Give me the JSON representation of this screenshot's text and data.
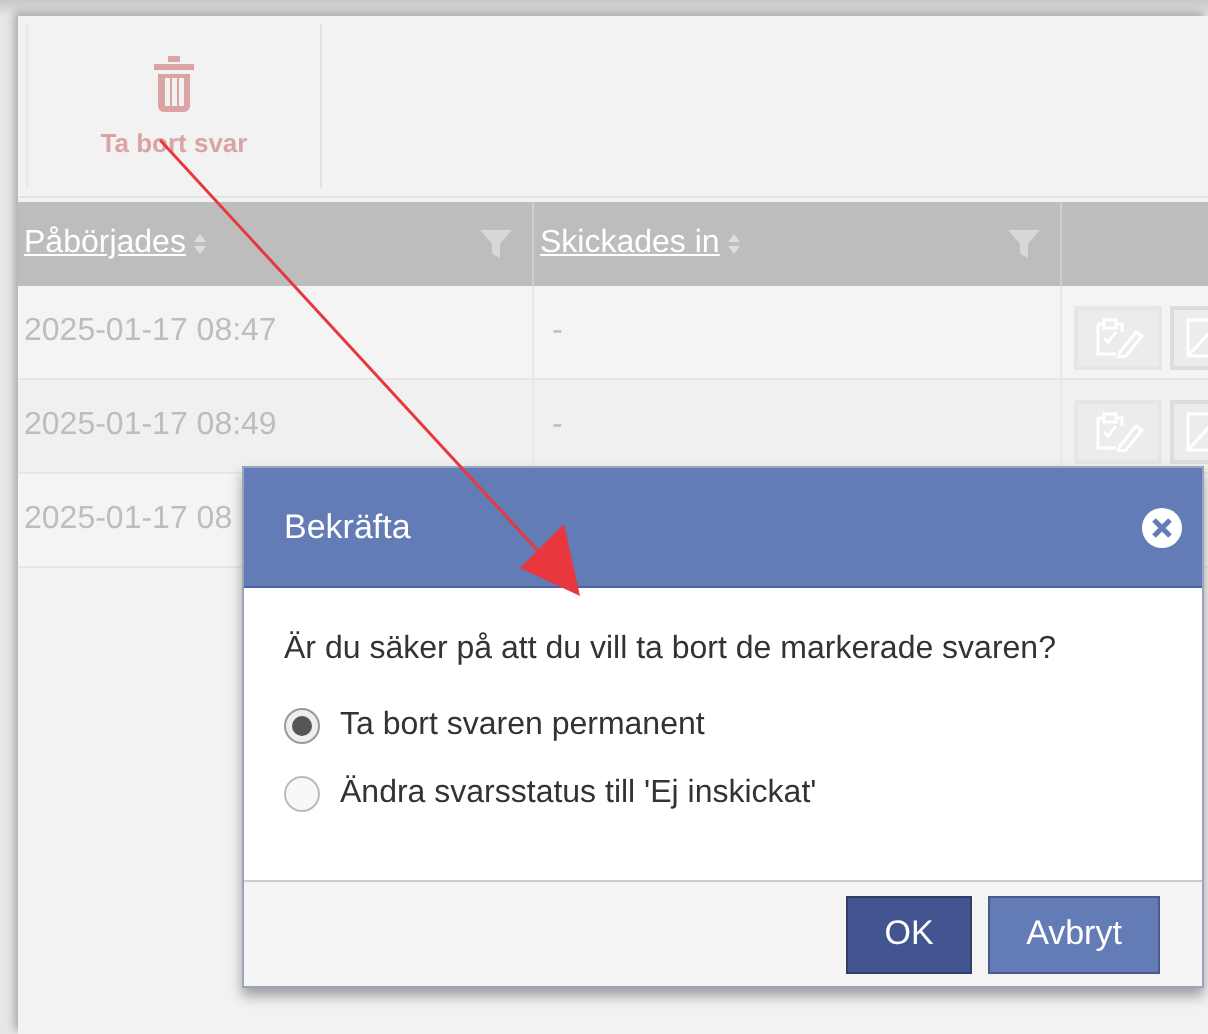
{
  "toolbar": {
    "buttons": [
      {
        "label": "Ta bort svar",
        "disabled": true
      }
    ]
  },
  "table": {
    "columns": [
      {
        "label": "Påbörjades"
      },
      {
        "label": "Skickades in"
      }
    ],
    "rows": [
      {
        "started": "2025-01-17 08:47",
        "submitted": "-"
      },
      {
        "started": "2025-01-17 08:49",
        "submitted": "-"
      },
      {
        "started": "2025-01-17 08"
      }
    ]
  },
  "dialog": {
    "title": "Bekräfta",
    "question": "Är du säker på att du vill ta bort de markerade svaren?",
    "options": [
      {
        "label": "Ta bort svaren permanent",
        "selected": true
      },
      {
        "label": "Ändra svarsstatus till 'Ej inskickat'",
        "selected": false
      }
    ],
    "buttons": [
      {
        "label": "OK",
        "kind": "primary"
      },
      {
        "label": "Avbryt",
        "kind": "secondary"
      }
    ]
  }
}
